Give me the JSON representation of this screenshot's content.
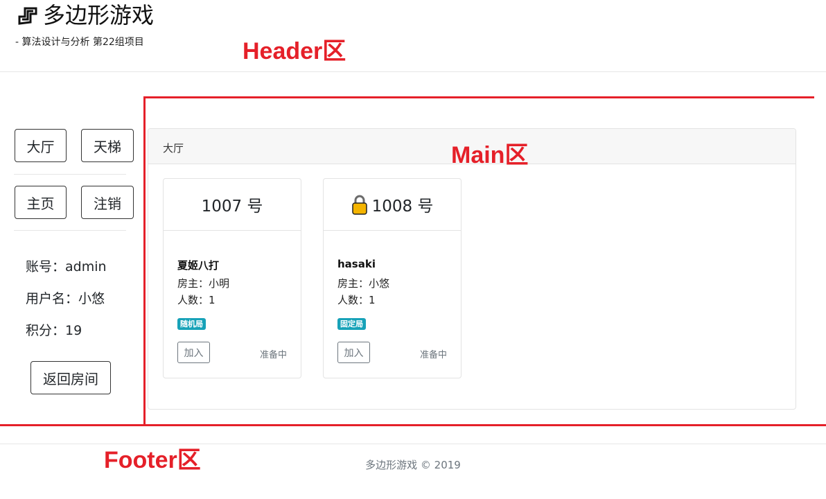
{
  "header": {
    "title": "多边形游戏",
    "subtitle": "- 算法设计与分析 第22组项目",
    "logo_icon": "polygon-logo-icon"
  },
  "annotations": {
    "header": "Header区",
    "main": "Main区",
    "footer": "Footer区",
    "color": "#e52029"
  },
  "sidebar": {
    "nav_buttons": [
      "大厅",
      "天梯",
      "主页",
      "注销"
    ],
    "account": "账号：admin",
    "username": "用户名：小悠",
    "score": "积分：19",
    "back_button": "返回房间"
  },
  "main": {
    "panel_title": "大厅",
    "rooms": [
      {
        "number": "1007 号",
        "locked": false,
        "name": "夏姬八打",
        "host": "房主：小明",
        "players": "人数：1",
        "badge": "随机局",
        "join_label": "加入",
        "status": "准备中"
      },
      {
        "number": "1008 号",
        "locked": true,
        "lock_icon": "lock-icon",
        "name": "hasaki",
        "host": "房主：小悠",
        "players": "人数：1",
        "badge": "固定局",
        "join_label": "加入",
        "status": "准备中"
      }
    ],
    "badge_color": "#17a2b8"
  },
  "footer": {
    "text": "多边形游戏 © 2019"
  }
}
